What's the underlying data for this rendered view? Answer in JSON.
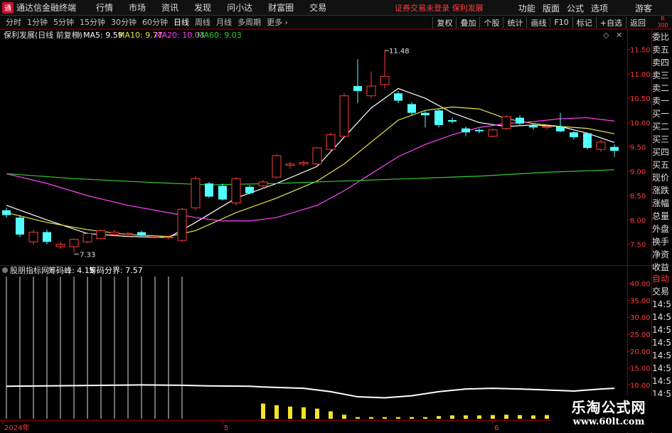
{
  "app": {
    "logo_glyph": "通",
    "title": "通达信金融终端",
    "menu": [
      "行情",
      "市场",
      "资讯",
      "发现",
      "问小达",
      "财富圈",
      "交易"
    ],
    "account_status": "证券交易未登录  保利发展",
    "right_menu": [
      "功能",
      "版面",
      "公式",
      "选项"
    ],
    "guest": "游客"
  },
  "toolbar": {
    "periods": [
      "分时",
      "1分钟",
      "5分钟",
      "15分钟",
      "30分钟",
      "60分钟",
      "日线",
      "周线",
      "月线",
      "多周期",
      "更多"
    ],
    "active_period": "日线",
    "buttons": [
      "复权",
      "叠加",
      "个股",
      "统计",
      "画线",
      "F10",
      "标记",
      "+自选",
      "返回"
    ],
    "corner": [
      "R",
      "300"
    ]
  },
  "main_panel": {
    "stock_label": "保利发展(日线 前复权)",
    "ma": [
      {
        "label": "MA5: 9.59",
        "color": "#ffffff"
      },
      {
        "label": "MA10: 9.77",
        "color": "#e8e84a"
      },
      {
        "label": "MA20: 10.03",
        "color": "#ff44ff"
      },
      {
        "label": "MA60: 9.03",
        "color": "#33cc33"
      }
    ],
    "max_annotation": "11.48",
    "min_annotation": "7.33"
  },
  "sub_panel": {
    "title": "股朋指标网",
    "items": [
      "筹码峰: 4.15",
      "筹码分界: 7.57"
    ]
  },
  "chart_data": {
    "type": "candlestick",
    "ylim": [
      7.1,
      11.7
    ],
    "y_ticks": [
      11.5,
      11.0,
      10.5,
      10.0,
      9.5,
      9.0,
      8.5,
      8.0,
      7.5
    ],
    "y_ticks_labels": [
      "11.50",
      "11.00",
      "10.50",
      "10.00",
      "9.50",
      "9.00",
      "8.50",
      "8.00",
      "7.50"
    ],
    "candles": [
      {
        "o": 8.2,
        "c": 8.1,
        "h": 8.25,
        "l": 8.05
      },
      {
        "o": 8.05,
        "c": 7.7,
        "h": 8.1,
        "l": 7.65
      },
      {
        "o": 7.55,
        "c": 7.75,
        "h": 7.8,
        "l": 7.5
      },
      {
        "o": 7.75,
        "c": 7.55,
        "h": 7.8,
        "l": 7.5
      },
      {
        "o": 7.45,
        "c": 7.5,
        "h": 7.55,
        "l": 7.4
      },
      {
        "o": 7.45,
        "c": 7.6,
        "h": 7.62,
        "l": 7.33
      },
      {
        "o": 7.55,
        "c": 7.72,
        "h": 7.75,
        "l": 7.52
      },
      {
        "o": 7.62,
        "c": 7.78,
        "h": 7.8,
        "l": 7.6
      },
      {
        "o": 7.7,
        "c": 7.75,
        "h": 7.8,
        "l": 7.65
      },
      {
        "o": 7.7,
        "c": 7.72,
        "h": 7.75,
        "l": 7.65
      },
      {
        "o": 7.75,
        "c": 7.68,
        "h": 7.78,
        "l": 7.65
      },
      {
        "o": 7.65,
        "c": 7.65,
        "h": 7.68,
        "l": 7.62
      },
      {
        "o": 7.65,
        "c": 7.65,
        "h": 7.68,
        "l": 7.6
      },
      {
        "o": 7.58,
        "c": 8.22,
        "h": 8.25,
        "l": 7.55
      },
      {
        "o": 8.25,
        "c": 8.85,
        "h": 8.9,
        "l": 8.2
      },
      {
        "o": 8.75,
        "c": 8.48,
        "h": 8.78,
        "l": 8.45
      },
      {
        "o": 8.7,
        "c": 8.42,
        "h": 8.75,
        "l": 8.4
      },
      {
        "o": 8.35,
        "c": 8.85,
        "h": 8.88,
        "l": 8.3
      },
      {
        "o": 8.68,
        "c": 8.55,
        "h": 8.72,
        "l": 8.52
      },
      {
        "o": 8.7,
        "c": 8.78,
        "h": 8.82,
        "l": 8.65
      },
      {
        "o": 8.88,
        "c": 9.32,
        "h": 9.35,
        "l": 8.85
      },
      {
        "o": 9.12,
        "c": 9.15,
        "h": 9.2,
        "l": 9.05
      },
      {
        "o": 9.15,
        "c": 9.18,
        "h": 9.22,
        "l": 9.1
      },
      {
        "o": 9.15,
        "c": 9.48,
        "h": 9.5,
        "l": 9.1
      },
      {
        "o": 9.45,
        "c": 9.75,
        "h": 9.8,
        "l": 9.4
      },
      {
        "o": 9.72,
        "c": 10.55,
        "h": 10.6,
        "l": 9.7
      },
      {
        "o": 10.75,
        "c": 10.65,
        "h": 11.3,
        "l": 10.4
      },
      {
        "o": 10.55,
        "c": 10.75,
        "h": 11.05,
        "l": 10.5
      },
      {
        "o": 10.78,
        "c": 10.95,
        "h": 11.48,
        "l": 10.7
      },
      {
        "o": 10.6,
        "c": 10.45,
        "h": 10.65,
        "l": 10.4
      },
      {
        "o": 10.38,
        "c": 10.2,
        "h": 10.42,
        "l": 10.15
      },
      {
        "o": 10.2,
        "c": 10.15,
        "h": 10.25,
        "l": 9.9
      },
      {
        "o": 10.25,
        "c": 9.95,
        "h": 10.28,
        "l": 9.9
      },
      {
        "o": 10.05,
        "c": 10.02,
        "h": 10.1,
        "l": 9.98
      },
      {
        "o": 9.88,
        "c": 9.8,
        "h": 9.92,
        "l": 9.72
      },
      {
        "o": 9.85,
        "c": 9.82,
        "h": 9.88,
        "l": 9.78
      },
      {
        "o": 9.72,
        "c": 9.85,
        "h": 9.88,
        "l": 9.7
      },
      {
        "o": 9.88,
        "c": 10.12,
        "h": 10.15,
        "l": 9.85
      },
      {
        "o": 10.1,
        "c": 9.98,
        "h": 10.15,
        "l": 9.95
      },
      {
        "o": 9.95,
        "c": 9.9,
        "h": 9.98,
        "l": 9.85
      },
      {
        "o": 9.9,
        "c": 9.92,
        "h": 9.95,
        "l": 9.85
      },
      {
        "o": 9.92,
        "c": 9.82,
        "h": 10.2,
        "l": 9.8
      },
      {
        "o": 9.8,
        "c": 9.7,
        "h": 9.82,
        "l": 9.65
      },
      {
        "o": 9.78,
        "c": 9.48,
        "h": 9.8,
        "l": 9.45
      },
      {
        "o": 9.45,
        "c": 9.6,
        "h": 9.65,
        "l": 9.4
      },
      {
        "o": 9.5,
        "c": 9.42,
        "h": 9.55,
        "l": 9.3
      }
    ],
    "ma_series": [
      {
        "name": "MA5",
        "color": "#ffffff",
        "points": [
          [
            0,
            8.3
          ],
          [
            3,
            8.0
          ],
          [
            6,
            7.72
          ],
          [
            9,
            7.66
          ],
          [
            12,
            7.64
          ],
          [
            14,
            7.95
          ],
          [
            17,
            8.45
          ],
          [
            20,
            8.75
          ],
          [
            23,
            9.1
          ],
          [
            25,
            9.7
          ],
          [
            27,
            10.3
          ],
          [
            29,
            10.7
          ],
          [
            31,
            10.5
          ],
          [
            33,
            10.2
          ],
          [
            35,
            10.0
          ],
          [
            37,
            9.92
          ],
          [
            39,
            9.95
          ],
          [
            41,
            9.92
          ],
          [
            43,
            9.78
          ],
          [
            45,
            9.59
          ]
        ]
      },
      {
        "name": "MA10",
        "color": "#e8e84a",
        "points": [
          [
            0,
            8.15
          ],
          [
            3,
            7.95
          ],
          [
            6,
            7.8
          ],
          [
            9,
            7.7
          ],
          [
            12,
            7.66
          ],
          [
            14,
            7.78
          ],
          [
            17,
            8.15
          ],
          [
            20,
            8.45
          ],
          [
            23,
            8.8
          ],
          [
            25,
            9.15
          ],
          [
            27,
            9.6
          ],
          [
            29,
            10.05
          ],
          [
            31,
            10.25
          ],
          [
            33,
            10.32
          ],
          [
            35,
            10.28
          ],
          [
            37,
            10.08
          ],
          [
            39,
            9.98
          ],
          [
            41,
            9.92
          ],
          [
            43,
            9.88
          ],
          [
            45,
            9.77
          ]
        ]
      },
      {
        "name": "MA20",
        "color": "#ff44ff",
        "points": [
          [
            0,
            8.95
          ],
          [
            3,
            8.75
          ],
          [
            6,
            8.5
          ],
          [
            9,
            8.3
          ],
          [
            12,
            8.15
          ],
          [
            14,
            8.05
          ],
          [
            16,
            7.98
          ],
          [
            18,
            7.98
          ],
          [
            20,
            8.05
          ],
          [
            23,
            8.3
          ],
          [
            25,
            8.6
          ],
          [
            27,
            8.95
          ],
          [
            29,
            9.3
          ],
          [
            31,
            9.55
          ],
          [
            33,
            9.75
          ],
          [
            35,
            9.9
          ],
          [
            37,
            9.98
          ],
          [
            39,
            10.02
          ],
          [
            41,
            10.08
          ],
          [
            43,
            10.1
          ],
          [
            45,
            10.03
          ]
        ]
      },
      {
        "name": "MA60",
        "color": "#33cc33",
        "points": [
          [
            0,
            8.95
          ],
          [
            5,
            8.85
          ],
          [
            10,
            8.78
          ],
          [
            15,
            8.72
          ],
          [
            20,
            8.75
          ],
          [
            25,
            8.8
          ],
          [
            30,
            8.85
          ],
          [
            35,
            8.9
          ],
          [
            40,
            8.98
          ],
          [
            45,
            9.03
          ]
        ]
      }
    ],
    "sub_ylim": [
      0,
      42
    ],
    "sub_ticks_labels": [
      "40.00",
      "35.00",
      "30.00",
      "25.00",
      "20.00",
      "15.00",
      "10.00",
      "5.00"
    ],
    "sub_tick_values": [
      40,
      35,
      30,
      25,
      20,
      15,
      10,
      5
    ],
    "sub_white_bar_count": 14,
    "sub_white_bar_value": 42,
    "sub_yellow_bars": [
      {
        "i": 19,
        "v": 4.5
      },
      {
        "i": 20,
        "v": 4.0
      },
      {
        "i": 21,
        "v": 3.6
      },
      {
        "i": 22,
        "v": 3.4
      },
      {
        "i": 23,
        "v": 3.0
      },
      {
        "i": 24,
        "v": 2.2
      },
      {
        "i": 25,
        "v": 1.2
      },
      {
        "i": 26,
        "v": 0.5
      },
      {
        "i": 27,
        "v": 0.5
      },
      {
        "i": 28,
        "v": 0.5
      },
      {
        "i": 29,
        "v": 0.5
      },
      {
        "i": 30,
        "v": 0.5
      },
      {
        "i": 31,
        "v": 0.5
      },
      {
        "i": 32,
        "v": 0.8
      },
      {
        "i": 33,
        "v": 1.0
      },
      {
        "i": 34,
        "v": 1.0
      },
      {
        "i": 35,
        "v": 1.0
      },
      {
        "i": 36,
        "v": 1.1
      },
      {
        "i": 37,
        "v": 1.2
      },
      {
        "i": 38,
        "v": 1.1
      },
      {
        "i": 39,
        "v": 1.0
      },
      {
        "i": 40,
        "v": 1.1
      },
      {
        "i": 41,
        "v": 1.0
      },
      {
        "i": 42,
        "v": 0.9
      },
      {
        "i": 43,
        "v": 1.0
      }
    ],
    "sub_line": [
      [
        0,
        9.6
      ],
      [
        5,
        9.8
      ],
      [
        10,
        10.0
      ],
      [
        13,
        9.9
      ],
      [
        15,
        9.7
      ],
      [
        18,
        9.6
      ],
      [
        19,
        9.4
      ],
      [
        22,
        9.0
      ],
      [
        24,
        8.0
      ],
      [
        26,
        6.5
      ],
      [
        28,
        6.2
      ],
      [
        30,
        6.8
      ],
      [
        32,
        8.0
      ],
      [
        34,
        8.8
      ],
      [
        36,
        9.0
      ],
      [
        38,
        8.8
      ],
      [
        40,
        8.5
      ],
      [
        42,
        8.2
      ],
      [
        44,
        8.8
      ],
      [
        45,
        9.0
      ]
    ],
    "x_labels": [
      {
        "i": 0,
        "label": "2024年"
      },
      {
        "i": 16,
        "label": "5"
      },
      {
        "i": 36,
        "label": "6"
      }
    ]
  },
  "side_panel": {
    "items": [
      "委比",
      "卖五",
      "卖四",
      "卖三",
      "卖二",
      "卖一",
      "买一",
      "买二",
      "买三",
      "买四",
      "买五",
      "现价",
      "涨跌",
      "涨幅",
      "总量",
      "外盘",
      "换手",
      "净资",
      "收益"
    ],
    "lower_items": [
      "自动",
      "交易",
      "14:56",
      "14:56",
      "14:56",
      "14:56",
      "14:56",
      "14:56",
      "14:56",
      "14:56"
    ],
    "lower_active": "自动"
  },
  "watermark": {
    "name": "乐淘公式网",
    "url": "www.60lt.com"
  }
}
